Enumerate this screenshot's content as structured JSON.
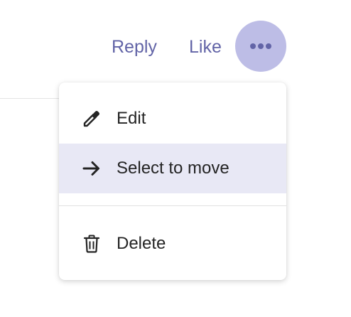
{
  "actions": {
    "reply_label": "Reply",
    "like_label": "Like",
    "more_icon": "more-horizontal-icon"
  },
  "menu": {
    "items": [
      {
        "label": "Edit",
        "icon": "pencil-icon",
        "selected": false
      },
      {
        "label": "Select to move",
        "icon": "arrow-right-icon",
        "selected": true
      },
      {
        "label": "Delete",
        "icon": "trash-icon",
        "selected": false
      }
    ]
  },
  "colors": {
    "accent": "#6264a7",
    "more_button_bg": "#bdbde6",
    "selected_item_bg": "#e8e8f5",
    "text": "#242424"
  }
}
